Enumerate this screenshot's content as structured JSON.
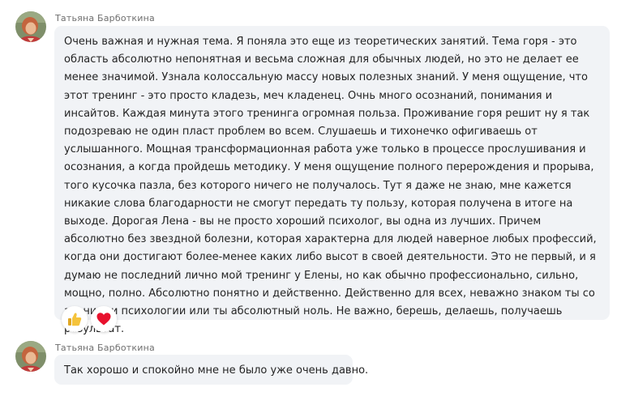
{
  "messages": [
    {
      "sender": "Татьяна  Барботкина",
      "text": "Очень важная и нужная тема. Я поняла это еще из теоретических занятий. Тема горя - это область абсолютно непонятная и весьма сложная для обычных людей, но это не делает ее менее значимой. Узнала колоссальную массу новых полезных знаний. У меня ощущение, что этот тренинг - это просто кладезь, меч кладенец. Очнь много осознаний, понимания и инсайтов. Каждая минута этого тренинга огромная польза. Проживание горя решит ну я так подозреваю не один пласт проблем во всем. Слушаешь и тихонечко офигиваешь от услышанного. Мощная трансформационная работа уже только в процессе прослушивания и осознания, а когда пройдешь методику. У меня ощущение полного перерождения и прорыва, того кусочка пазла, без которого ничего не получалось. Тут я даже не знаю, мне кажется никакие слова благодарности не смогут передать ту пользу, которая получена в итоге на выходе. Дорогая Лена - вы не просто хороший психолог, вы одна из лучших. Причем абсолютно без звездной болезни, которая характерна для людей наверное любых профессий, когда они достигают более-менее каких либо высот в своей деятельности. Это не первый, и я думаю не последний лично мой тренинг у Елены, но как обычно профессионально, сильно, мощно, полно. Абсолютно понятно и действенно. Действенно для всех, неважно знаком ты со знаниями психологии или ты абсолютный ноль. Не важно, берешь, делаешь, получаешь результат.",
      "reactions": [
        {
          "icon": "thumbs-up-icon",
          "color": "#f5c33b"
        },
        {
          "icon": "heart-icon",
          "color": "#e8112d"
        }
      ]
    },
    {
      "sender": "Татьяна  Барботкина",
      "text": "Так хорошо и спокойно мне не было уже очень давно."
    }
  ],
  "colors": {
    "bubble_background": "#f1f3f6",
    "sender_name": "#6f6f6f",
    "message_text": "#242424"
  }
}
